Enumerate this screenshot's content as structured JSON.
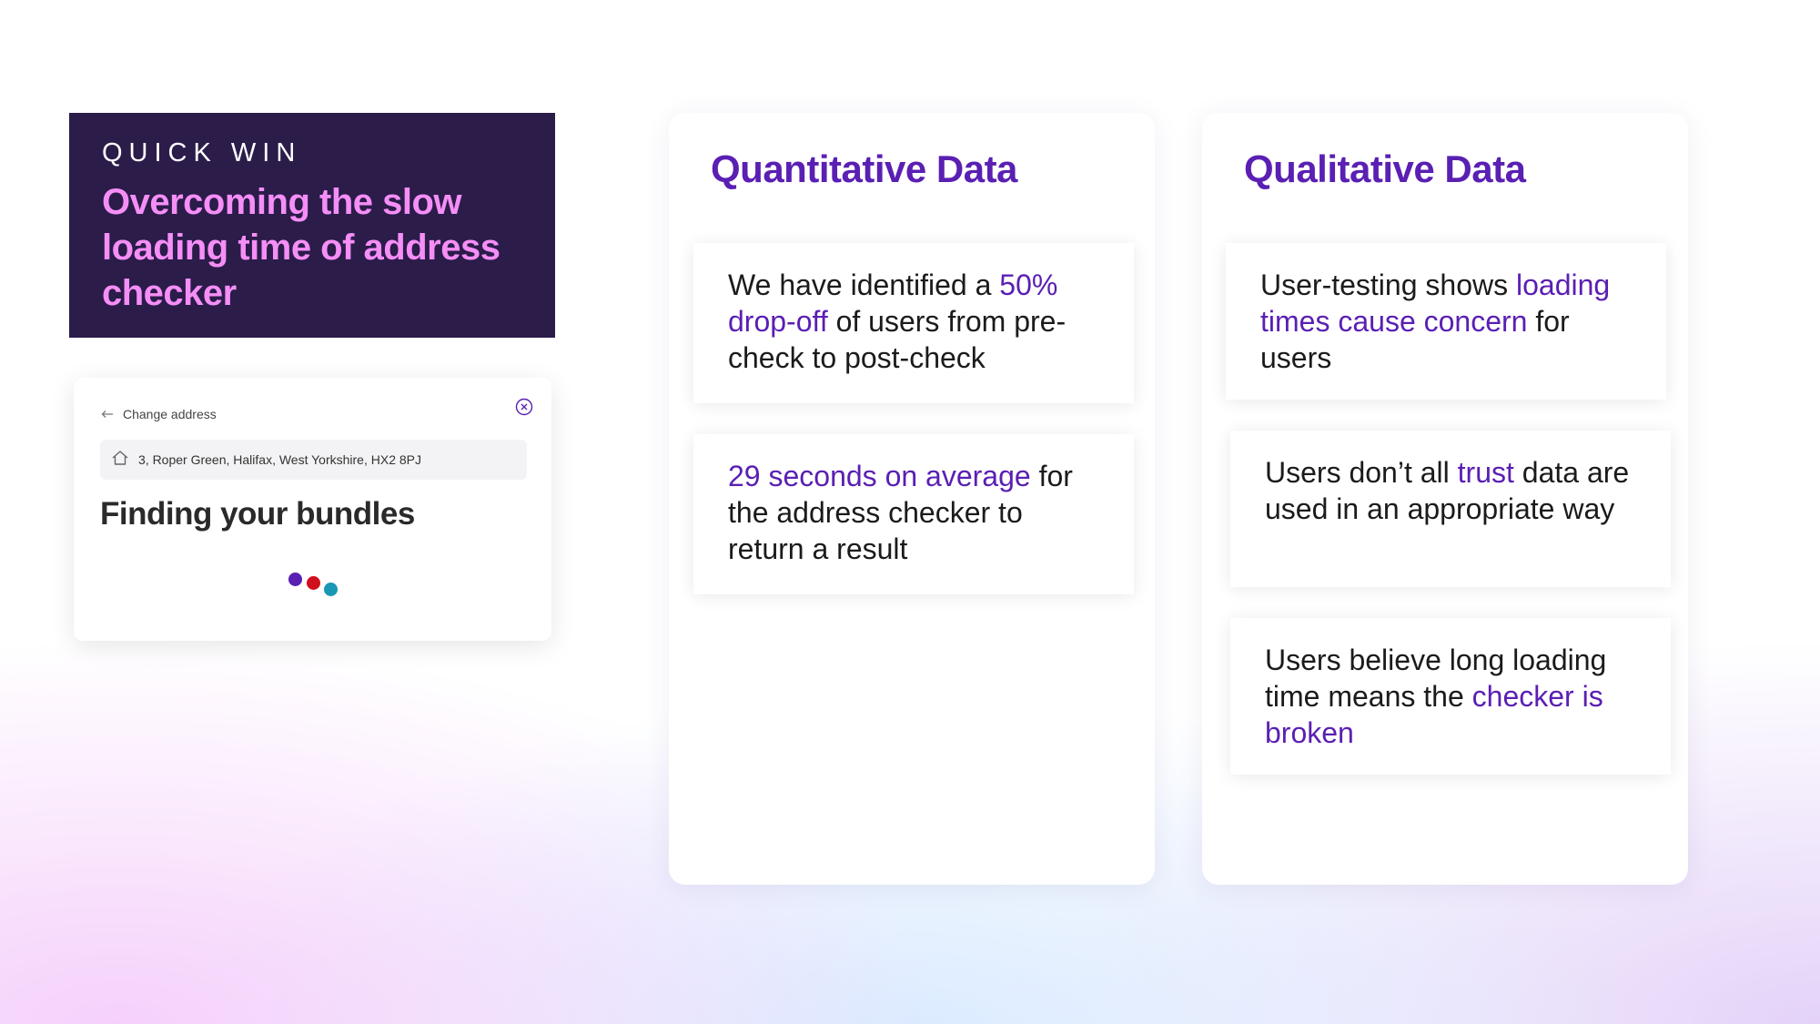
{
  "quick_win": {
    "kicker": "QUICK WIN",
    "title": "Overcoming the slow loading time of address checker"
  },
  "mockup": {
    "back_label": "Change address",
    "address_value": "3, Roper Green, Halifax, West Yorkshire, HX2 8PJ",
    "heading": "Finding your bundles",
    "loader_colors": [
      "#5a1fb3",
      "#d0101d",
      "#1a97b5"
    ]
  },
  "quantitative": {
    "title": "Quantitative Data",
    "cards": [
      {
        "parts": [
          {
            "text": "We have identified a ",
            "hl": false
          },
          {
            "text": "50% drop-off",
            "hl": true
          },
          {
            "text": " of users from pre-check to post-check",
            "hl": false
          }
        ]
      },
      {
        "parts": [
          {
            "text": "29 seconds on average",
            "hl": true
          },
          {
            "text": " for the address checker to return a result",
            "hl": false
          }
        ]
      }
    ]
  },
  "qualitative": {
    "title": "Qualitative Data",
    "cards": [
      {
        "parts": [
          {
            "text": "User-testing shows ",
            "hl": false
          },
          {
            "text": "loading times cause concern",
            "hl": true
          },
          {
            "text": " for users",
            "hl": false
          }
        ]
      },
      {
        "parts": [
          {
            "text": "Users don’t all ",
            "hl": false
          },
          {
            "text": "trust",
            "hl": true
          },
          {
            "text": " data are used in an appropriate way",
            "hl": false
          }
        ]
      },
      {
        "parts": [
          {
            "text": "Users believe long loading time means the ",
            "hl": false
          },
          {
            "text": "checker is broken",
            "hl": true
          }
        ]
      }
    ]
  },
  "colors": {
    "accent": "#5a1fb3",
    "quick_win_bg": "#2b1c4a",
    "quick_win_title": "#f58ef6"
  }
}
